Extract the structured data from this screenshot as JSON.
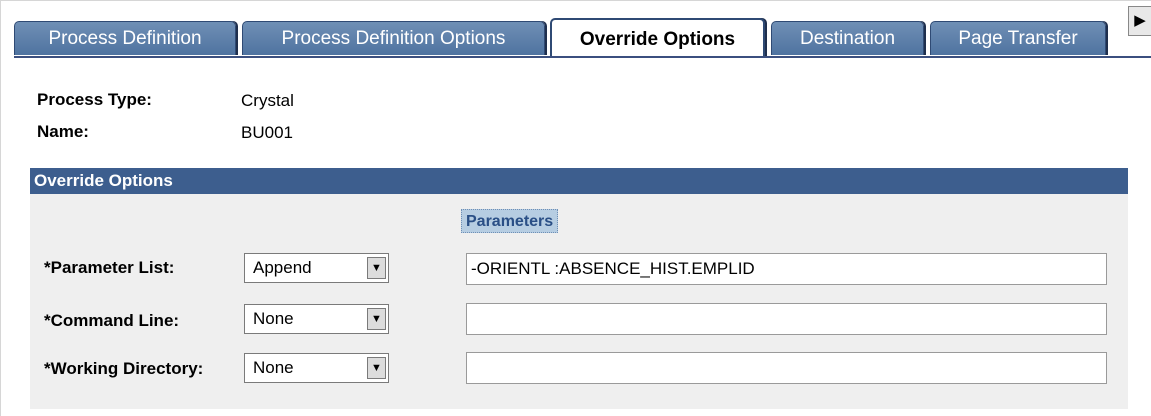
{
  "tabs": [
    {
      "label": "Process Definition",
      "active": false
    },
    {
      "label": "Process Definition Options",
      "active": false
    },
    {
      "label": "Override Options",
      "active": true
    },
    {
      "label": "Destination",
      "active": false
    },
    {
      "label": "Page Transfer",
      "active": false
    }
  ],
  "tab_scroll_icon": "right-arrow",
  "process_type": {
    "label": "Process Type:",
    "value": "Crystal"
  },
  "name": {
    "label": "Name:",
    "value": "BU001"
  },
  "section": {
    "title": "Override Options",
    "parameters_header": "Parameters"
  },
  "fields": [
    {
      "label": "*Parameter List:",
      "select": "Append",
      "text": "-ORIENTL :ABSENCE_HIST.EMPLID"
    },
    {
      "label": "*Command Line:",
      "select": "None",
      "text": ""
    },
    {
      "label": "*Working Directory:",
      "select": "None",
      "text": ""
    }
  ],
  "colors": {
    "tab_bg": "#5b7fad",
    "section_header_bg": "#3d5e8e",
    "parameters_header_bg": "#b6cde2",
    "section_body_bg": "#efefef"
  }
}
